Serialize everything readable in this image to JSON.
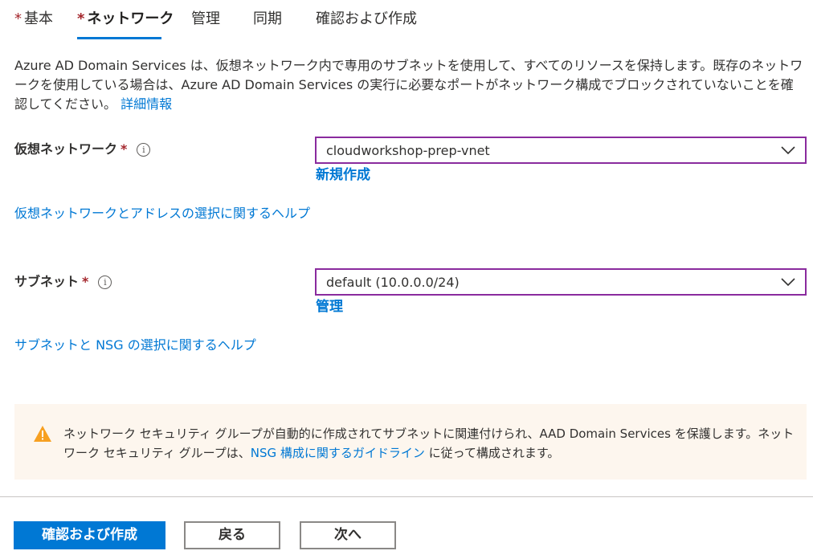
{
  "tabs": [
    {
      "label": "基本",
      "required": "*"
    },
    {
      "label": "ネットワーク",
      "required": "*"
    },
    {
      "label": "管理"
    },
    {
      "label": "同期"
    },
    {
      "label": "確認および作成"
    }
  ],
  "intro": {
    "text": "Azure AD Domain Services は、仮想ネットワーク内で専用のサブネットを使用して、すべてのリソースを保持します。既存のネットワークを使用している場合は、Azure AD Domain Services の実行に必要なポートがネットワーク構成でブロックされていないことを確認してください。",
    "link": "詳細情報"
  },
  "vnet": {
    "label": "仮想ネットワーク",
    "required": "*",
    "info": "i",
    "value": "cloudworkshop-prep-vnet",
    "action": "新規作成",
    "help": "仮想ネットワークとアドレスの選択に関するヘルプ"
  },
  "subnet": {
    "label": "サブネット",
    "required": "*",
    "info": "i",
    "value": "default (10.0.0.0/24)",
    "action": "管理",
    "help": "サブネットと NSG の選択に関するヘルプ"
  },
  "notice": {
    "icon": "warning-icon",
    "text_before": "ネットワーク セキュリティ グループが自動的に作成されてサブネットに関連付けられ、AAD Domain Services を保護します。ネットワーク セキュリティ グループは、",
    "link": "NSG 構成に関するガイドライン",
    "text_after": " に従って構成されます。",
    "background": "#fdf6ee",
    "icon_color": "#f7a021"
  },
  "footer": {
    "primary": "確認および作成",
    "back": "戻る",
    "next": "次へ"
  },
  "colors": {
    "accent": "#0078d4",
    "required": "#a4262c",
    "focus_border": "#8a2b9e"
  }
}
